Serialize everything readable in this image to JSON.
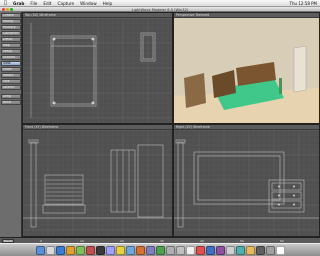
{
  "menubar": {
    "app_name": "Grab",
    "items": [
      "File",
      "Edit",
      "Capture",
      "Window",
      "Help"
    ],
    "clock": "Thu 12:58 PM"
  },
  "window": {
    "title": "LightWave Modeler 8.5 (Win32)"
  },
  "toolbar": {
    "buttons": [
      {
        "label": "Create",
        "selected": false
      },
      {
        "label": "Modify",
        "selected": false
      },
      {
        "label": "Multiply",
        "selected": false
      },
      {
        "label": "Construct",
        "selected": false
      },
      {
        "label": "Detail",
        "selected": false
      },
      {
        "label": "Map",
        "selected": false
      },
      {
        "label": "Setup",
        "selected": false
      },
      {
        "label": "Utilities",
        "selected": false
      },
      {
        "label": "View",
        "selected": true
      },
      {
        "label": "Move",
        "selected": false
      },
      {
        "label": "Rotate",
        "selected": false
      },
      {
        "label": "Size",
        "selected": false
      },
      {
        "label": "Stretch",
        "selected": false
      }
    ],
    "lower_buttons": [
      {
        "label": "Drag",
        "selected": false
      },
      {
        "label": "Bend",
        "selected": false
      }
    ]
  },
  "viewports": {
    "top": {
      "header": "Top (XZ) Wireframe"
    },
    "perspective": {
      "header": "Perspective Textured"
    },
    "front": {
      "header": "Front (XY) Wireframe"
    },
    "right": {
      "header": "Right (ZY) Wireframe"
    }
  },
  "timeline": {
    "mode_label": "Points",
    "ticks": [
      "0",
      "10",
      "20",
      "30",
      "40",
      "50",
      "60"
    ]
  },
  "dock": {
    "icon_colors": [
      "#5b8fd8",
      "#d9d9d9",
      "#3a7bd5",
      "#e0a030",
      "#7fbf5a",
      "#c05050",
      "#3a3a3a",
      "#a0a0ff",
      "#e8d040",
      "#6fa8dc",
      "#d87030",
      "#8080c0",
      "#50a050",
      "#b0b0b0",
      "#c0c0c0",
      "#f0f0f0",
      "#e05050",
      "#4070c0",
      "#9050a0",
      "#d0d0d0",
      "#50b0b0",
      "#e8b860",
      "#606060",
      "#a0a0a0",
      "#ffffff"
    ]
  },
  "colors": {
    "viewport_bg": "#505050",
    "grid_minor": "#5e5e5e",
    "grid_major": "#6c6c6c",
    "wire": "#cfcfcf",
    "floor": "#e8d3b0",
    "bed_base": "#3fc88a",
    "headboard": "#6b4a2a"
  }
}
